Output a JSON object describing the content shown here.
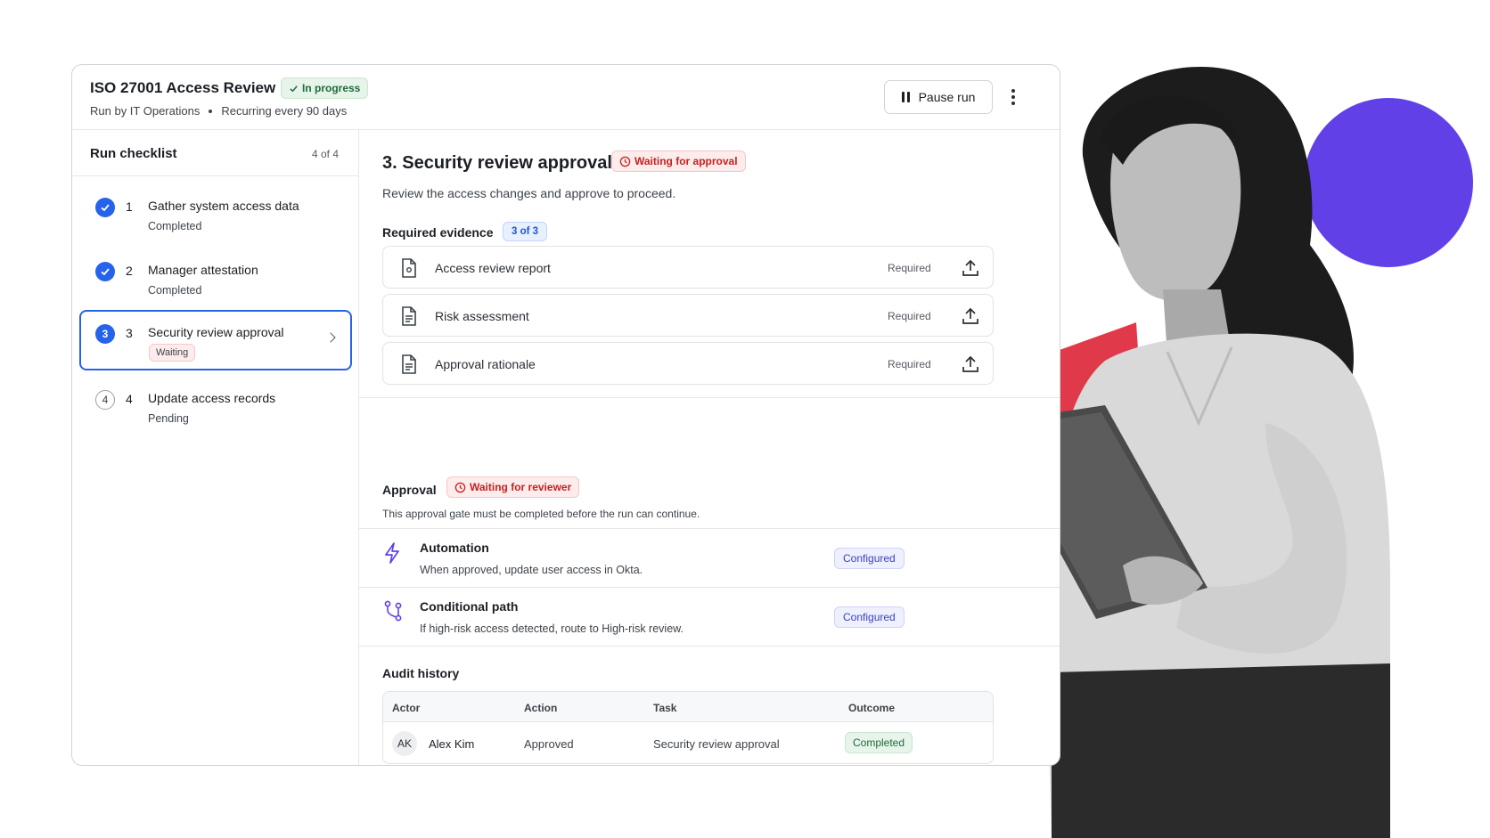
{
  "colors": {
    "accent_blue": "#2563eb",
    "purple": "#6240e8",
    "red_shape": "#e03a4a",
    "success_green": "#1e6b39",
    "danger_red": "#c5221f"
  },
  "run": {
    "title": "ISO 27001 Access Review",
    "status": "In progress",
    "run_by": "Run by IT Operations",
    "recurrence": "Recurring every 90 days",
    "pause_label": "Pause run",
    "menu_icon": "more-vertical-icon"
  },
  "checklist": {
    "title": "Run checklist",
    "count": "4 of 4",
    "steps": [
      {
        "num": "1",
        "label": "Gather system access data",
        "status": "Completed",
        "state": "done"
      },
      {
        "num": "2",
        "label": "Manager attestation",
        "status": "Completed",
        "state": "done"
      },
      {
        "num": "3",
        "label": "Security review approval",
        "status": "Waiting",
        "state": "current",
        "icon_text": "3"
      },
      {
        "num": "4",
        "label": "Update access records",
        "status": "Pending",
        "state": "pending",
        "icon_text": "4"
      }
    ]
  },
  "task": {
    "title": "3. Security review approval",
    "status": "Waiting for approval",
    "description": "Review the access changes and approve to proceed.",
    "evidence_title": "Required evidence",
    "evidence_count": "3 of 3",
    "evidence": [
      {
        "name": "Access review report",
        "requirement": "Required",
        "icon": "file-icon"
      },
      {
        "name": "Risk assessment",
        "requirement": "Required",
        "icon": "document-icon"
      },
      {
        "name": "Approval rationale",
        "requirement": "Required",
        "icon": "document-icon"
      }
    ]
  },
  "approval": {
    "title": "Approval",
    "status": "Waiting for reviewer",
    "description": "This approval gate must be completed before the run can continue.",
    "automation": {
      "title": "Automation",
      "description": "When approved, update user access in Okta.",
      "badge": "Configured",
      "icon": "lightning-icon"
    },
    "conditional": {
      "title": "Conditional path",
      "description": "If high-risk access detected, route to High-risk review.",
      "badge": "Configured",
      "icon": "branch-icon"
    }
  },
  "audit": {
    "title": "Audit history",
    "columns": [
      "Actor",
      "Action",
      "Task",
      "Outcome"
    ],
    "rows": [
      {
        "initials": "AK",
        "actor": "Alex Kim",
        "action": "Approved",
        "task": "Security review approval",
        "outcome": "Completed"
      }
    ]
  }
}
